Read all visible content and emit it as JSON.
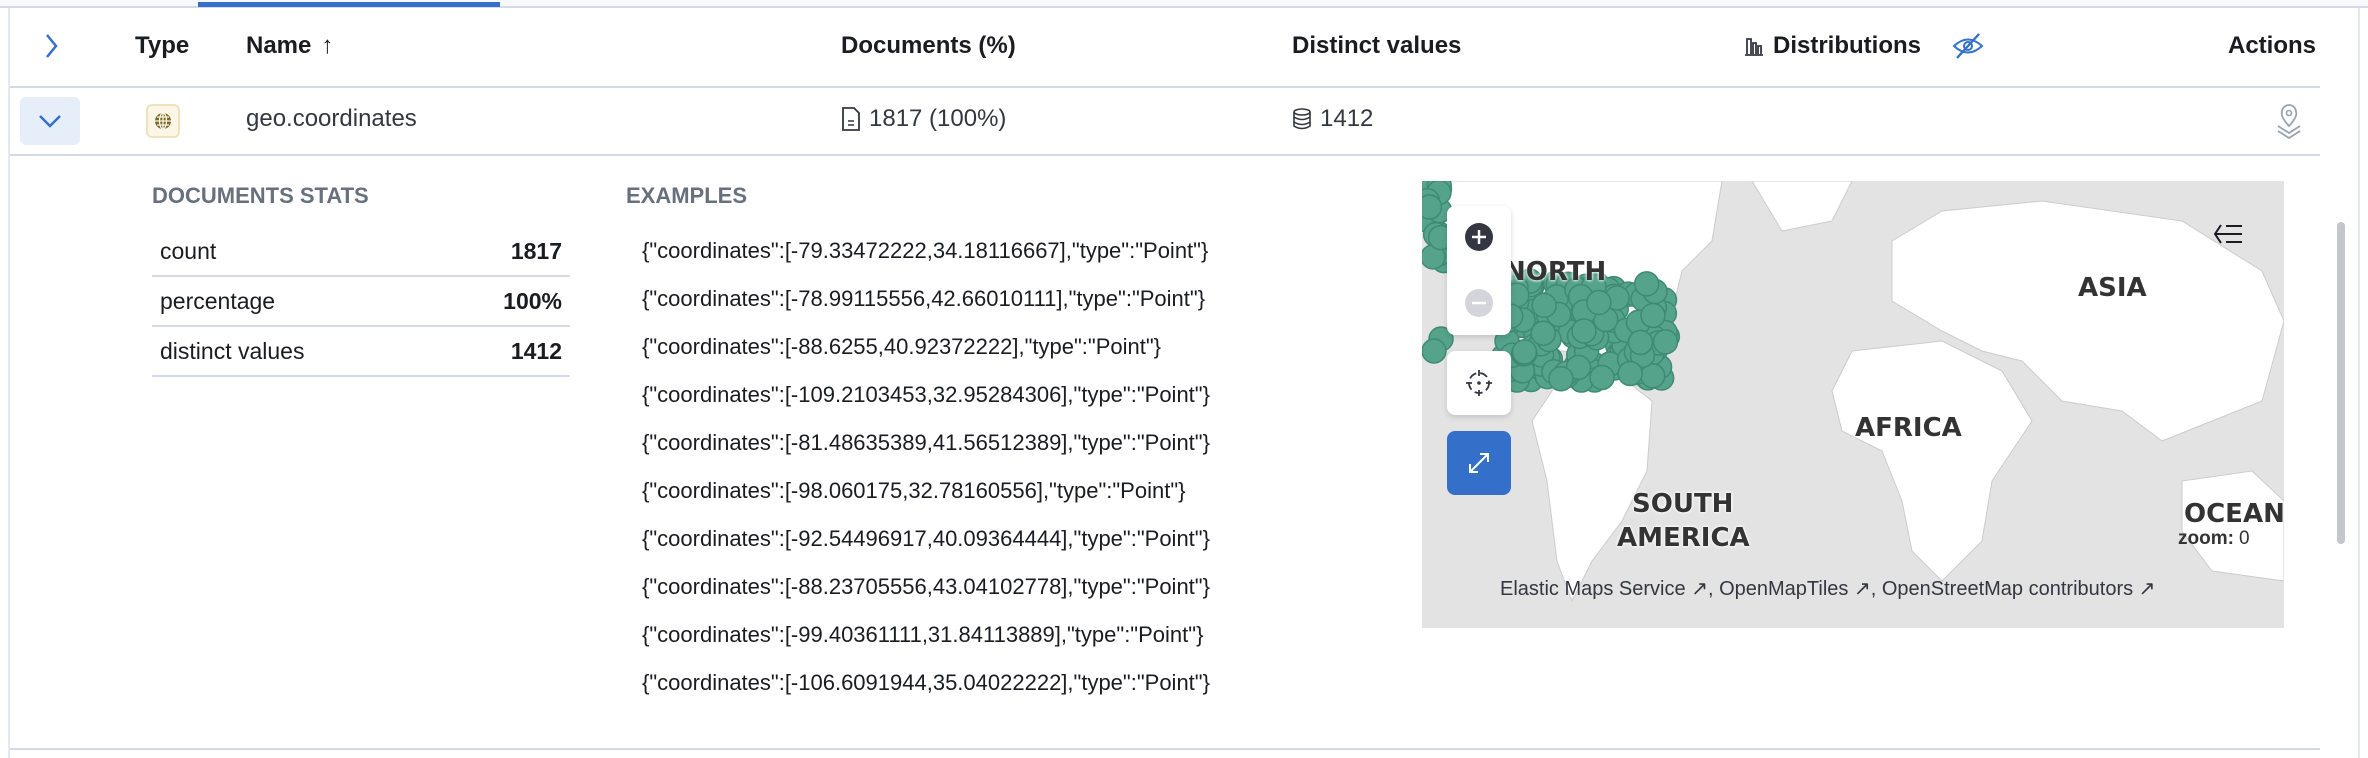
{
  "header": {
    "type": "Type",
    "name": "Name",
    "documents": "Documents (%)",
    "distinct": "Distinct values",
    "distributions": "Distributions",
    "actions": "Actions"
  },
  "row": {
    "name": "geo.coordinates",
    "documents": "1817 (100%)",
    "distinct": "1412"
  },
  "stats": {
    "title": "DOCUMENTS STATS",
    "rows": [
      {
        "label": "count",
        "value": "1817"
      },
      {
        "label": "percentage",
        "value": "100%"
      },
      {
        "label": "distinct values",
        "value": "1412"
      }
    ]
  },
  "examples": {
    "title": "EXAMPLES",
    "items": [
      "{\"coordinates\":[-79.33472222,34.18116667],\"type\":\"Point\"}",
      "{\"coordinates\":[-78.99115556,42.66010111],\"type\":\"Point\"}",
      "{\"coordinates\":[-88.6255,40.92372222],\"type\":\"Point\"}",
      "{\"coordinates\":[-109.2103453,32.95284306],\"type\":\"Point\"}",
      "{\"coordinates\":[-81.48635389,41.56512389],\"type\":\"Point\"}",
      "{\"coordinates\":[-98.060175,32.78160556],\"type\":\"Point\"}",
      "{\"coordinates\":[-92.54496917,40.09364444],\"type\":\"Point\"}",
      "{\"coordinates\":[-88.23705556,43.04102778],\"type\":\"Point\"}",
      "{\"coordinates\":[-99.40361111,31.84113889],\"type\":\"Point\"}",
      "{\"coordinates\":[-106.6091944,35.04022222],\"type\":\"Point\"}"
    ]
  },
  "map": {
    "labels": {
      "north": "NORTH",
      "asia": "ASIA",
      "africa": "AFRICA",
      "south1": "SOUTH",
      "south2": "AMERICA",
      "oceania": "OCEANI"
    },
    "zoom_label": "zoom:",
    "zoom_value": "0",
    "attribution": [
      "Elastic Maps Service",
      "OpenMapTiles",
      "OpenStreetMap contributors"
    ],
    "point_color": "#54a38a"
  }
}
